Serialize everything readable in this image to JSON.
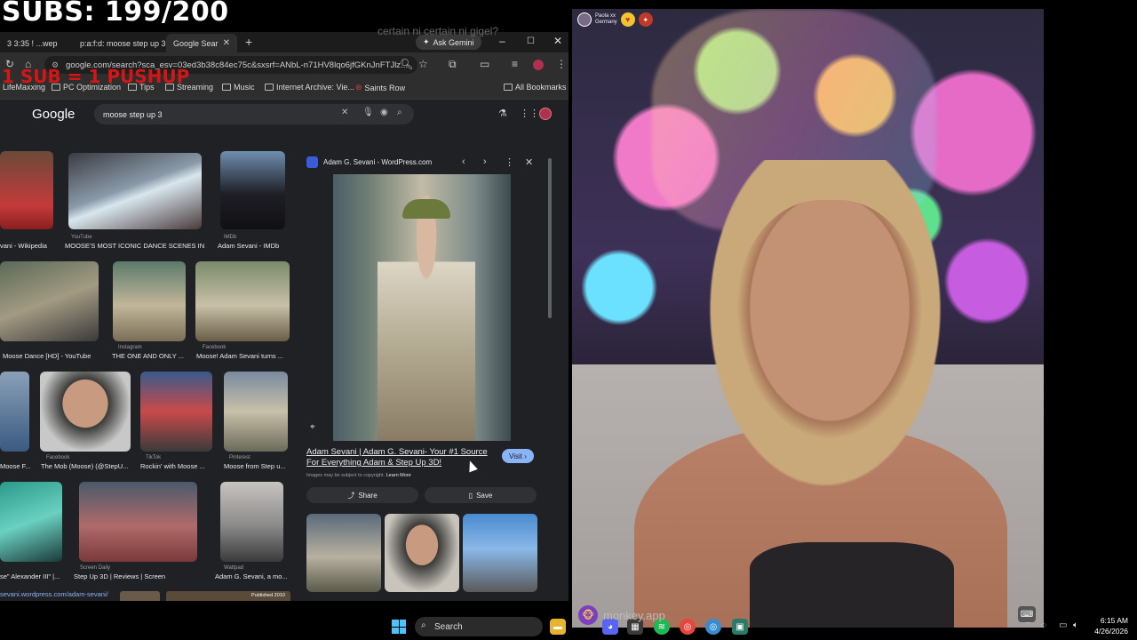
{
  "overlay": {
    "subs": "SUBS: 199/200",
    "pushup": "1 SUB = 1 PUSHUP",
    "ghost": "certain ni certain ni gigel?"
  },
  "browser": {
    "tabs": [
      {
        "label": "3 3:35 ! ...wep"
      },
      {
        "label": "p:a:f:d: moose step up 3"
      },
      {
        "label": "Google Sear"
      }
    ],
    "gemini_label": "Ask Gemini",
    "url": "google.com/search?sca_esv=03ed3b38c84ec75c&sxsrf=ANbL-n71HV8lqo6jfGKnJnFTJlz...",
    "bookmarks": [
      {
        "label": "LifeMaxxing"
      },
      {
        "label": "PC Optimization"
      },
      {
        "label": "Tips"
      },
      {
        "label": "Streaming"
      },
      {
        "label": "Music"
      },
      {
        "label": "Internet Archive: Vie..."
      },
      {
        "label": "Saints Row"
      }
    ],
    "all_bookmarks": "All Bookmarks"
  },
  "google": {
    "logo": "Google",
    "query": "moose step up 3",
    "results": [
      {
        "src": "",
        "title": "vani - Wikipedia"
      },
      {
        "src": "YouTube",
        "title": "MOOSE'S MOST ICONIC DANCE SCENES IN ..."
      },
      {
        "src": "IMDb",
        "title": "Adam Sevani - IMDb"
      },
      {
        "src": "",
        "title": "Moose Dance [HD] - YouTube"
      },
      {
        "src": "Instagram",
        "title": "THE ONE AND ONLY ..."
      },
      {
        "src": "Facebook",
        "title": "Moose! Adam Sevani turns ..."
      },
      {
        "src": "",
        "title": "Moose F..."
      },
      {
        "src": "Facebook",
        "title": "The Mob (Moose) (@StepU..."
      },
      {
        "src": "TikTok",
        "title": "Rockin' with Moose ..."
      },
      {
        "src": "Pinterest",
        "title": "Moose from Step u..."
      },
      {
        "src": "",
        "title": "se\" Alexander III\" |..."
      },
      {
        "src": "Screen Daily",
        "title": "Step Up 3D | Reviews | Screen"
      },
      {
        "src": "Wattpad",
        "title": "Adam G. Sevani, a mo..."
      }
    ],
    "footer_url": "sevani.wordpress.com/adam-sevani/",
    "published": "Published 2010"
  },
  "preview": {
    "site": "Adam G. Sevani - WordPress.com",
    "title": "Adam Sevani | Adam G. Sevani- Your #1 Source For Everything Adam & Step Up 3D!",
    "visit": "Visit",
    "copyright": "Images may be subject to copyright.",
    "learn_more": "Learn More",
    "share": "Share",
    "save": "Save"
  },
  "video": {
    "user_name": "Paola xx",
    "user_country": "Germany",
    "app_name": "monkey.app"
  },
  "taskbar": {
    "search": "Search",
    "time": "6:15 AM",
    "date": "4/26/2026"
  },
  "colors": {
    "google_bg": "#202124",
    "visit_btn": "#8ab4f8",
    "pushup_red": "#e01414",
    "monkey_purple": "#7b3fbf"
  }
}
